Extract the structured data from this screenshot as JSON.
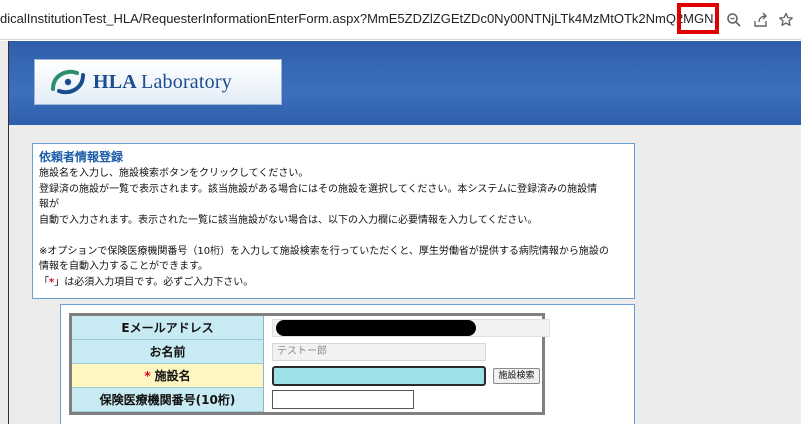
{
  "browser": {
    "url": "dicalInstitutionTest_HLA/RequesterInformationEnterForm.aspx?MmE5ZDZlZGEtZDc0Ny00NTNjLTk4MzMtOTk2NmQ2MGN...",
    "icons": [
      "zoom-icon",
      "share-icon",
      "bookmark-star-icon"
    ]
  },
  "header": {
    "logo_text_bold": "HLA",
    "logo_text_rest": "Laboratory",
    "band_color": "#3d6fbd"
  },
  "info": {
    "title": "依頼者情報登録",
    "lines": [
      "施設名を入力し、施設検索ボタンをクリックしてください。",
      "登録済の施設が一覧で表示されます。該当施設がある場合にはその施設を選択してください。本システムに登録済みの施設情",
      "報が",
      "自動で入力されます。表示された一覧に該当施設がない場合は、以下の入力欄に必要情報を入力してください。",
      "",
      "※オプションで保険医療機関番号（10桁）を入力して施設検索を行っていただくと、厚生労働省が提供する病院情報から施設の",
      "情報を自動入力することができます。"
    ],
    "required_note_prefix": "「",
    "required_note_mark": "*",
    "required_note_suffix": "」は必須入力項目です。必ずご入力下さい。"
  },
  "form": {
    "email_label": "Eメールアドレス",
    "name_label": "お名前",
    "name_value": "テストー郎",
    "facility_required_mark": "*",
    "facility_label": "施設名",
    "facility_search_button": "施設検索",
    "insurance_code_label": "保険医療機関番号(10桁)"
  }
}
